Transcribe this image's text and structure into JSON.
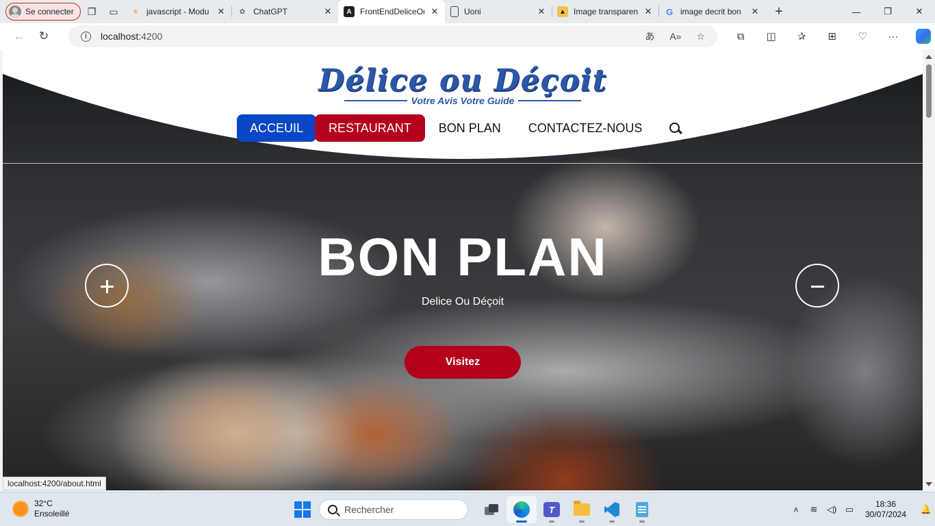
{
  "browser": {
    "profile_label": "Se connecter",
    "tabs": [
      {
        "title": "javascript - Modu",
        "icon": "stackoverflow-icon",
        "active": false
      },
      {
        "title": "ChatGPT",
        "icon": "chatgpt-icon",
        "active": false
      },
      {
        "title": "FrontEndDeliceOu",
        "icon": "angular-icon",
        "active": true
      },
      {
        "title": "Uoni",
        "icon": "document-icon",
        "active": false
      },
      {
        "title": "Image transparen",
        "icon": "hat-icon",
        "active": false
      },
      {
        "title": "image decrit bon",
        "icon": "google-icon",
        "active": false
      }
    ],
    "url_host": "localhost:",
    "url_port": "4200",
    "status_url": "localhost:4200/about.html"
  },
  "site": {
    "logo_title": "Délice ou Déçoit",
    "logo_tagline": "Votre Avis  Votre Guide",
    "nav": [
      {
        "label": "ACCEUIL",
        "state": "home"
      },
      {
        "label": "RESTAURANT",
        "state": "highlight"
      },
      {
        "label": "BON PLAN",
        "state": "plain"
      },
      {
        "label": "CONTACTEZ-NOUS",
        "state": "plain"
      }
    ],
    "hero_title": "BON PLAN",
    "hero_subtitle": "Delice Ou Déçoit",
    "cta_label": "Visitez",
    "colors": {
      "primary_blue": "#0b46c4",
      "accent_red": "#b3001b",
      "logo_blue": "#2c57a8"
    }
  },
  "taskbar": {
    "weather_temp": "32°C",
    "weather_desc": "Ensoleillé",
    "search_placeholder": "Rechercher",
    "time": "18:36",
    "date": "30/07/2024"
  }
}
